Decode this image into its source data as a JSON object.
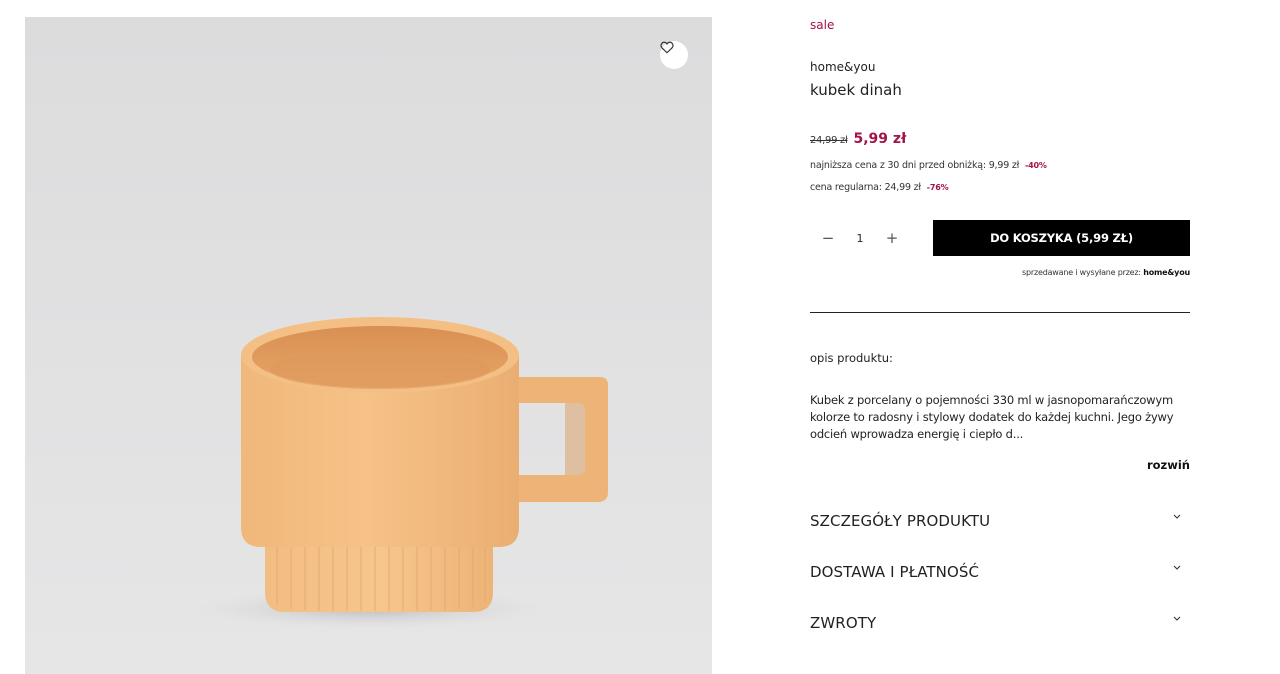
{
  "image": {
    "alt": "kubek dinah",
    "wishlist_icon": "heart-icon"
  },
  "product": {
    "sale_label": "sale",
    "brand": "home&you",
    "title": "kubek dinah",
    "old_price": "24,99 zł",
    "new_price": "5,99 zł",
    "lowest_price_note": "najniższa cena z 30 dni przed obniżką: 9,99 zł",
    "lowest_price_discount": "-40%",
    "regular_price_note": "cena regularna: 24,99 zł",
    "regular_price_discount": "-76%",
    "colors": {
      "accent": "#a3124a",
      "button_bg": "#000000"
    }
  },
  "purchase": {
    "decrement_label": "−",
    "quantity": "1",
    "increment_label": "+",
    "add_to_cart_label": "DO KOSZYKA  (5,99 ZŁ)",
    "seller_prefix": "sprzedawane i wysyłane przez:",
    "seller_name": "home&you"
  },
  "description": {
    "heading": "opis produktu:",
    "text": "Kubek z porcelany o pojemności 330 ml w jasnopomarańczowym kolorze to radosny i stylowy dodatek do każdej kuchni. Jego żywy odcień wprowadza energię i ciepło d...",
    "expand_label": "rozwiń"
  },
  "accordions": [
    {
      "label": "SZCZEGÓŁY PRODUKTU",
      "icon": "chevron-down-icon"
    },
    {
      "label": "DOSTAWA I PŁATNOŚĆ",
      "icon": "chevron-down-icon"
    },
    {
      "label": "ZWROTY",
      "icon": "chevron-down-icon"
    }
  ]
}
